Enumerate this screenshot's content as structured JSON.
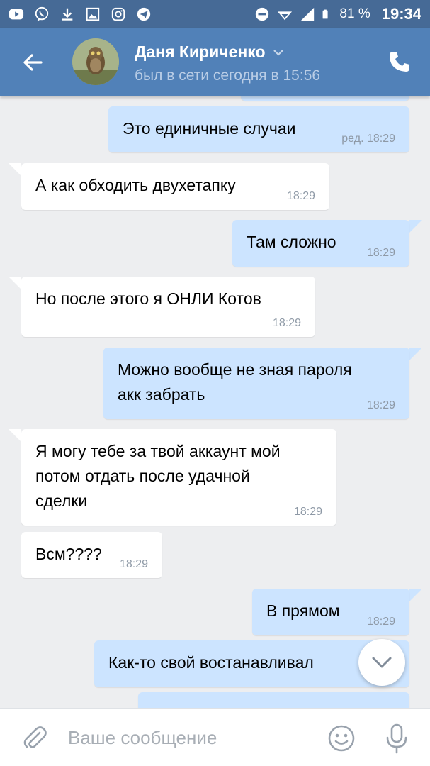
{
  "status_bar": {
    "battery_percent": "81 %",
    "time": "19:34",
    "icons": [
      "youtube-icon",
      "viber-icon",
      "download-icon",
      "gallery-icon",
      "instagram-icon",
      "telegram-icon",
      "dnd-icon",
      "wifi-icon",
      "signal-icon",
      "battery-icon"
    ]
  },
  "header": {
    "contact_name": "Даня Кириченко",
    "contact_status": "был в сети сегодня в 15:56",
    "colors": {
      "accent": "#5181b8",
      "status_bar": "#466a96"
    }
  },
  "messages": [
    {
      "direction": "out",
      "text": "Это единичные случаи",
      "time": "ред. 18:29"
    },
    {
      "direction": "in",
      "text": "А как обходить двухетапку",
      "time": "18:29"
    },
    {
      "direction": "out",
      "text": "Там сложно",
      "time": "18:29"
    },
    {
      "direction": "in",
      "text": "Но после этого я ОНЛИ Котов",
      "time": "18:29"
    },
    {
      "direction": "out",
      "text": "Можно вообще не зная пароля\nакк забрать",
      "time": "18:29"
    },
    {
      "direction": "in",
      "text": "Я могу тебе за твой аккаунт мой\nпотом отдать после удачной\nсделки",
      "time": "18:29"
    },
    {
      "direction": "in",
      "text": "Всм????",
      "time": "18:29"
    },
    {
      "direction": "out",
      "text": "В прямом",
      "time": "18:29"
    },
    {
      "direction": "out",
      "text": "Как-то свой востанавливал",
      "time": ""
    }
  ],
  "input": {
    "placeholder": "Ваше сообщение",
    "value": ""
  },
  "bubble_colors": {
    "incoming": "#ffffff",
    "outgoing": "#cce4ff"
  }
}
